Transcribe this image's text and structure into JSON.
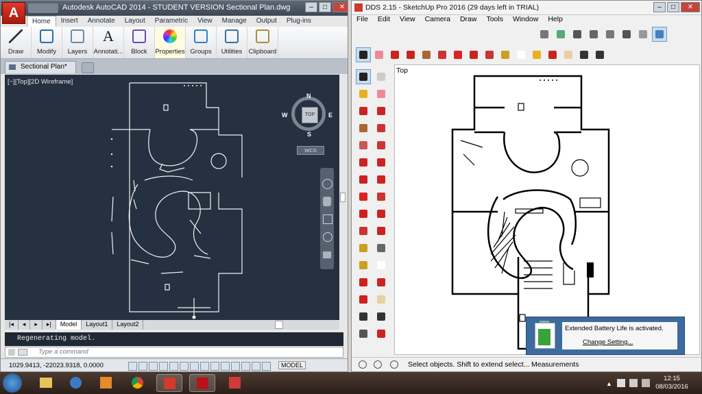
{
  "acad": {
    "title": "Autodesk AutoCAD 2014 - STUDENT VERSION     Sectional Plan.dwg",
    "app_letter": "A",
    "tabs": [
      {
        "label": "Home",
        "active": true
      },
      {
        "label": "Insert"
      },
      {
        "label": "Annotate"
      },
      {
        "label": "Layout"
      },
      {
        "label": "Parametric"
      },
      {
        "label": "View"
      },
      {
        "label": "Manage"
      },
      {
        "label": "Output"
      },
      {
        "label": "Plug-ins"
      }
    ],
    "ribbon": [
      {
        "label": "Draw",
        "icon": "line-icon"
      },
      {
        "label": "Modify",
        "icon": "move-icon"
      },
      {
        "label": "Layers",
        "icon": "layers-icon"
      },
      {
        "label": "Annotati...",
        "icon": "text-icon"
      },
      {
        "label": "Block",
        "icon": "block-icon"
      },
      {
        "label": "Properties",
        "icon": "color-wheel-icon"
      },
      {
        "label": "Groups",
        "icon": "groups-icon"
      },
      {
        "label": "Utilities",
        "icon": "measure-icon"
      },
      {
        "label": "Clipboard",
        "icon": "clipboard-icon"
      }
    ],
    "doc_tab": "Sectional Plan*",
    "viewport_label": "[−][Top][2D Wireframe]",
    "viewcube": {
      "n": "N",
      "s": "S",
      "e": "E",
      "w": "W",
      "top": "TOP",
      "wcs": "WCS"
    },
    "layout_tabs": [
      "Model",
      "Layout1",
      "Layout2"
    ],
    "command_history": "Regenerating model.",
    "command_placeholder": "Type a command",
    "coords": "1029.9413, -22023.9318, 0.0000",
    "status_model": "MODEL"
  },
  "skp": {
    "title": "DDS 2.15 - SketchUp Pro 2016 (29 days left in TRIAL)",
    "menu": [
      "File",
      "Edit",
      "View",
      "Camera",
      "Draw",
      "Tools",
      "Window",
      "Help"
    ],
    "viewport_label": "Top",
    "status_hint": "Select objects. Shift to extend select...",
    "status_measurements": "Measurements"
  },
  "notification": {
    "message": "Extended Battery Life is activated.",
    "link": "Change Setting..."
  },
  "taskbar": {
    "time": "12:15",
    "date": "08/03/2016"
  }
}
